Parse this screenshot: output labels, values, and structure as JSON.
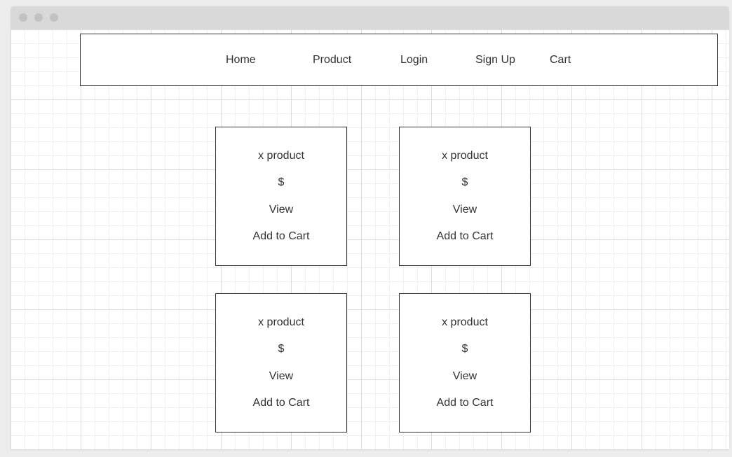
{
  "nav": {
    "items": [
      {
        "label": "Home"
      },
      {
        "label": "Product"
      },
      {
        "label": "Login"
      },
      {
        "label": "Sign Up"
      },
      {
        "label": "Cart"
      }
    ]
  },
  "products": [
    {
      "name": "x product",
      "price": "$",
      "view_label": "View",
      "add_label": "Add to Cart"
    },
    {
      "name": "x product",
      "price": "$",
      "view_label": "View",
      "add_label": "Add to Cart"
    },
    {
      "name": "x product",
      "price": "$",
      "view_label": "View",
      "add_label": "Add to Cart"
    },
    {
      "name": "x product",
      "price": "$",
      "view_label": "View",
      "add_label": "Add to Cart"
    }
  ]
}
